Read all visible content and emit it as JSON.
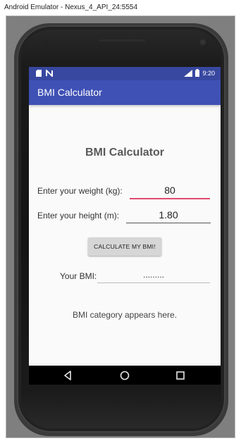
{
  "window": {
    "title": "Android Emulator - Nexus_4_API_24:5554"
  },
  "statusbar": {
    "time": "9:20",
    "icons": [
      "sd-card-icon",
      "n-notification-icon",
      "signal-icon",
      "battery-icon"
    ]
  },
  "app": {
    "toolbar_title": "BMI Calculator",
    "heading": "BMI Calculator",
    "weight": {
      "label": "Enter your weight (kg):",
      "value": "80"
    },
    "height": {
      "label": "Enter your height (m):",
      "value": "1.80"
    },
    "calculate_button": "CALCULATE MY BMI!",
    "result": {
      "label": "Your BMI:",
      "value": "........."
    },
    "category_text": "BMI category appears here."
  },
  "navbar": {
    "buttons": [
      "back-icon",
      "home-icon",
      "recents-icon"
    ]
  },
  "colors": {
    "primary": "#3f51b5",
    "primary_dark": "#3848a0",
    "accent": "#e04a6e"
  }
}
